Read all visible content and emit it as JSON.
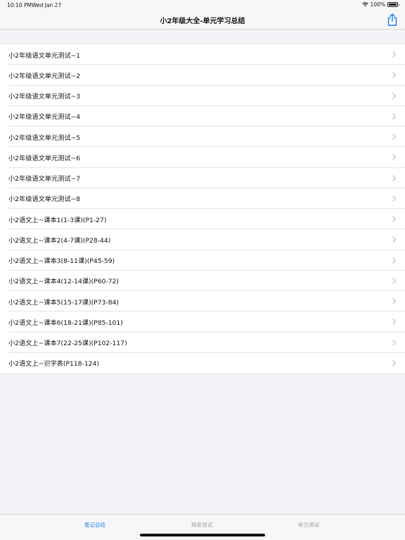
{
  "status_bar": {
    "time": "10:10 PM",
    "date": "Wed Jan 27",
    "battery": "100%"
  },
  "nav": {
    "title": "小2年级大全-单元学习总结",
    "share_icon": "share-icon"
  },
  "list": {
    "items": [
      {
        "label": "小2年级语文单元测试~1"
      },
      {
        "label": "小2年级语文单元测试~2"
      },
      {
        "label": "小2年级语文单元测试~3"
      },
      {
        "label": "小2年级语文单元测试~4"
      },
      {
        "label": "小2年级语文单元测试~5"
      },
      {
        "label": "小2年级语文单元测试~6"
      },
      {
        "label": "小2年级语文单元测试~7"
      },
      {
        "label": "小2年级语文单元测试~8"
      },
      {
        "label": "小2语文上~课本1(1-3课)(P1-27)"
      },
      {
        "label": "小2语文上~课本2(4-7课)(P28-44)"
      },
      {
        "label": "小2语文上~课本3(8-11课)(P45-59)"
      },
      {
        "label": "小2语文上~课本4(12-14课)(P60-72)"
      },
      {
        "label": "小2语文上~课本5(15-17课)(P73-84)"
      },
      {
        "label": "小2语文上~课本6(18-21课)(P85-101)"
      },
      {
        "label": "小2语文上~课本7(22-25课)(P102-117)"
      },
      {
        "label": "小2语文上~识字表(P118-124)"
      }
    ]
  },
  "tabs": [
    {
      "label": "笔记总结",
      "active": true
    },
    {
      "label": "简答测试",
      "active": false
    },
    {
      "label": "听力测试",
      "active": false
    }
  ],
  "colors": {
    "accent": "#1a7cf5",
    "background": "#f2f2f7",
    "inactive_tab": "#9a9a9f"
  }
}
